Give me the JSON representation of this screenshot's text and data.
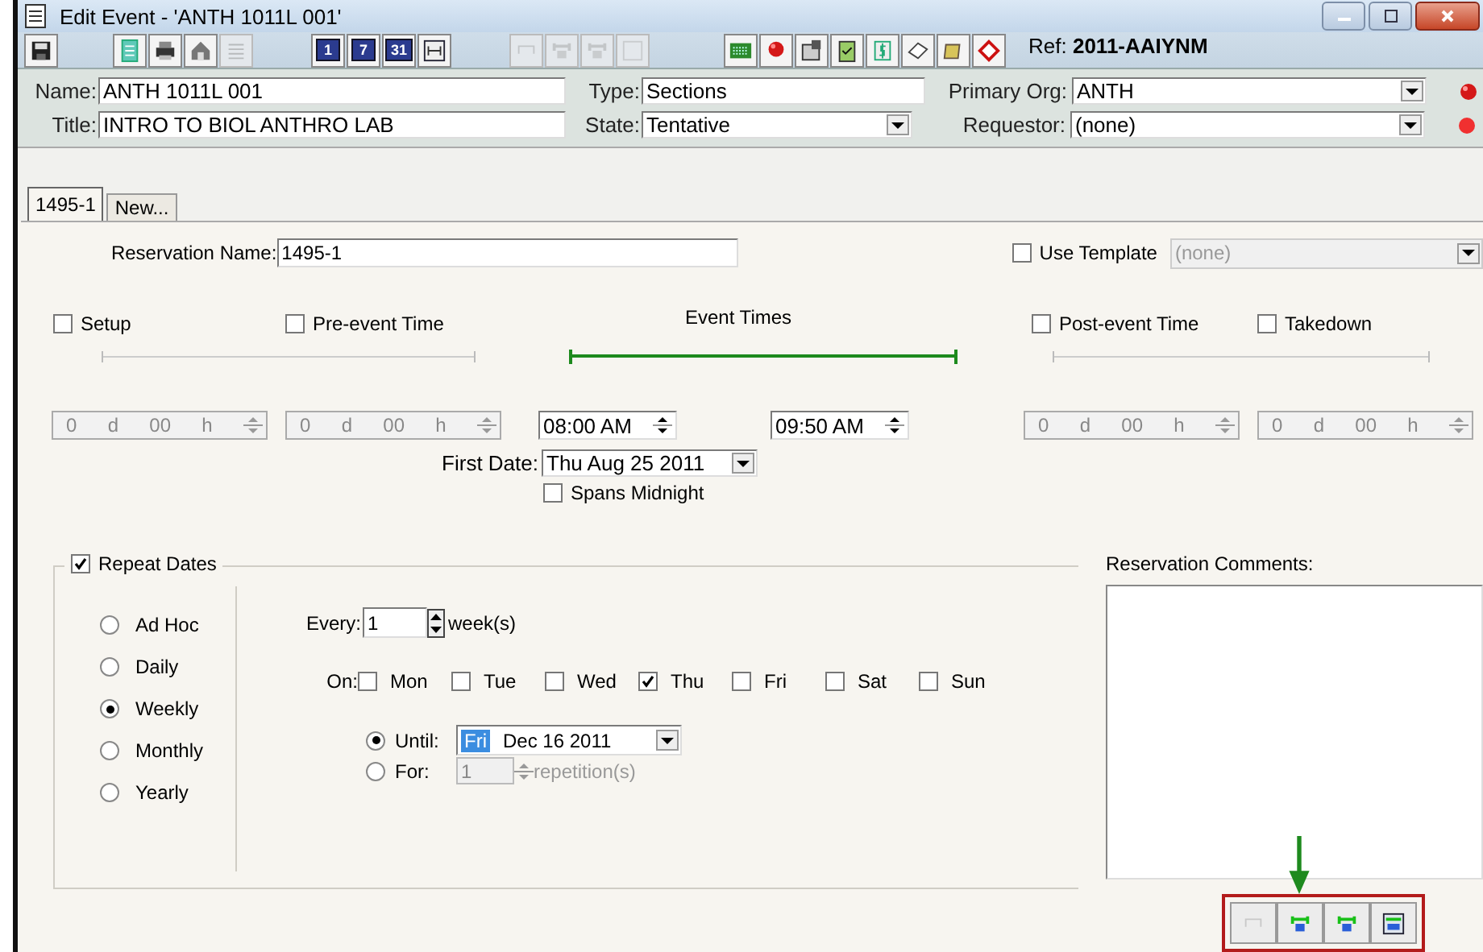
{
  "window": {
    "title": "Edit Event - 'ANTH 1011L 001'"
  },
  "toolbar": {
    "groups": [
      [
        {
          "kind": "save",
          "disabled": false
        }
      ],
      [
        {
          "kind": "document",
          "disabled": false
        },
        {
          "kind": "print",
          "disabled": false
        },
        {
          "kind": "house",
          "disabled": false
        },
        {
          "kind": "list",
          "disabled": true
        }
      ],
      [
        {
          "kind": "calendar",
          "label": "1",
          "disabled": false
        },
        {
          "kind": "calendar",
          "label": "7",
          "disabled": false
        },
        {
          "kind": "calendar",
          "label": "31",
          "disabled": false
        },
        {
          "kind": "fit",
          "disabled": false
        }
      ],
      [
        {
          "kind": "bracket",
          "disabled": true
        },
        {
          "kind": "link",
          "disabled": true
        },
        {
          "kind": "link",
          "disabled": true
        },
        {
          "kind": "blank",
          "disabled": true
        }
      ],
      [
        {
          "kind": "grid",
          "disabled": false
        },
        {
          "kind": "pin",
          "disabled": false
        },
        {
          "kind": "properties",
          "disabled": false
        },
        {
          "kind": "clipboard",
          "disabled": false
        },
        {
          "kind": "dollar",
          "disabled": false
        },
        {
          "kind": "tag",
          "disabled": false
        },
        {
          "kind": "scroll",
          "disabled": false
        },
        {
          "kind": "diamond",
          "disabled": false
        }
      ]
    ],
    "ref_label": "Ref:",
    "ref_value": "2011-AAIYNM"
  },
  "header": {
    "name": {
      "label": "Name:",
      "value": "ANTH 1011L 001"
    },
    "type": {
      "label": "Type:",
      "value": "Sections"
    },
    "primary_org": {
      "label": "Primary Org:",
      "value": "ANTH"
    },
    "title": {
      "label": "Title:",
      "value": "INTRO TO BIOL ANTHRO LAB"
    },
    "state": {
      "label": "State:",
      "value": "Tentative"
    },
    "requestor": {
      "label": "Requestor:",
      "value": "(none)"
    }
  },
  "tabs": [
    {
      "label": "1495-1",
      "selected": true
    },
    {
      "label": "New...",
      "selected": false
    }
  ],
  "reservation": {
    "name_label": "Reservation Name:",
    "name_value": "1495-1",
    "use_template": {
      "label": "Use Template",
      "checked": false,
      "value": "(none)",
      "disabled": true
    }
  },
  "phases": {
    "setup": {
      "label": "Setup",
      "checked": false
    },
    "pre_event": {
      "label": "Pre-event Time",
      "checked": false
    },
    "event_times": "Event Times",
    "post_event": {
      "label": "Post-event Time",
      "checked": false
    },
    "takedown": {
      "label": "Takedown",
      "checked": false
    }
  },
  "durations": [
    {
      "days": "0",
      "day_unit": "d",
      "hours": "00",
      "hour_unit": "h",
      "disabled": true
    },
    {
      "days": "0",
      "day_unit": "d",
      "hours": "00",
      "hour_unit": "h",
      "disabled": true
    },
    {
      "days": "0",
      "day_unit": "d",
      "hours": "00",
      "hour_unit": "h",
      "disabled": true
    },
    {
      "days": "0",
      "day_unit": "d",
      "hours": "00",
      "hour_unit": "h",
      "disabled": true
    }
  ],
  "start_time": "08:00 AM",
  "end_time": "09:50 AM",
  "first_date": {
    "label": "First Date:",
    "value": "Thu Aug 25 2011"
  },
  "spans_midnight": {
    "label": "Spans Midnight",
    "checked": false
  },
  "repeat": {
    "label": "Repeat Dates",
    "checked": true,
    "patterns": [
      {
        "label": "Ad Hoc",
        "selected": false
      },
      {
        "label": "Daily",
        "selected": false
      },
      {
        "label": "Weekly",
        "selected": true
      },
      {
        "label": "Monthly",
        "selected": false
      },
      {
        "label": "Yearly",
        "selected": false
      }
    ],
    "every_label": "Every:",
    "every_value": "1",
    "every_unit": "week(s)",
    "on_label": "On:",
    "days": [
      {
        "label": "Mon",
        "checked": false
      },
      {
        "label": "Tue",
        "checked": false
      },
      {
        "label": "Wed",
        "checked": false
      },
      {
        "label": "Thu",
        "checked": true
      },
      {
        "label": "Fri",
        "checked": false
      },
      {
        "label": "Sat",
        "checked": false
      },
      {
        "label": "Sun",
        "checked": false
      }
    ],
    "until": {
      "label": "Until:",
      "selected": true,
      "day": "Fri",
      "date": "Dec 16 2011"
    },
    "for": {
      "label": "For:",
      "selected": false,
      "value": "1",
      "unit": "repetition(s)",
      "disabled": true
    }
  },
  "comments": {
    "label": "Reservation Comments:"
  },
  "bottom_toolbar": {
    "highlighted": true,
    "buttons": [
      {
        "kind": "bracket",
        "disabled": true,
        "pointed": false
      },
      {
        "kind": "link-down",
        "disabled": false,
        "pointed": true
      },
      {
        "kind": "link-down",
        "disabled": false,
        "pointed": false
      },
      {
        "kind": "link-box",
        "disabled": false,
        "pointed": false
      }
    ]
  }
}
